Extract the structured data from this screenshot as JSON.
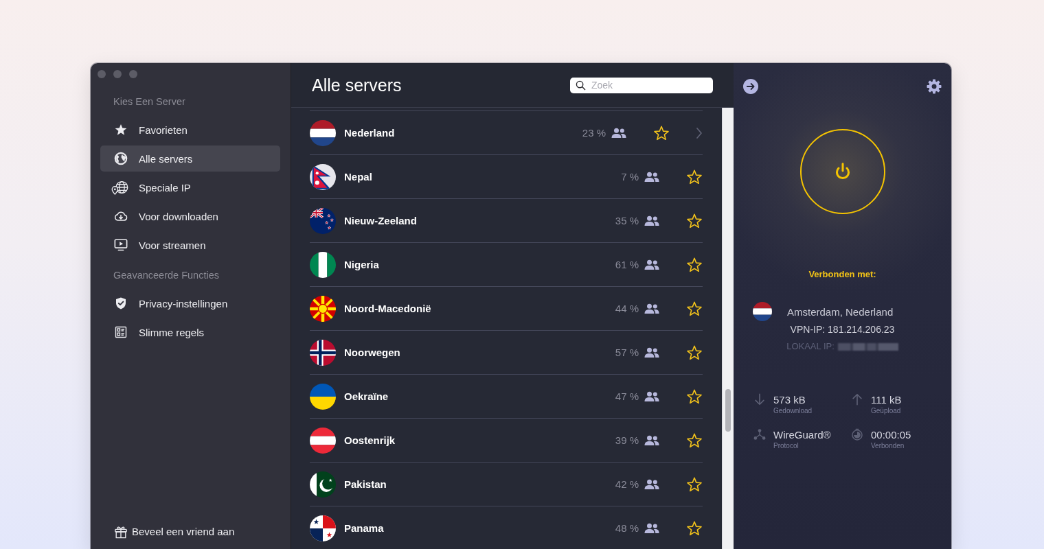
{
  "sidebar": {
    "sections": [
      {
        "heading": "Kies Een Server",
        "items": [
          {
            "label": "Favorieten",
            "kind": "favorites",
            "selected": false
          },
          {
            "label": "Alle servers",
            "kind": "global",
            "selected": true
          },
          {
            "label": "Speciale IP",
            "kind": "dedicated",
            "selected": false
          },
          {
            "label": "Voor downloaden",
            "kind": "downloading",
            "selected": false
          },
          {
            "label": "Voor streamen",
            "kind": "streaming",
            "selected": false
          }
        ]
      },
      {
        "heading": "Geavanceerde Functies",
        "items": [
          {
            "label": "Privacy-instellingen",
            "kind": "privacy",
            "selected": false
          },
          {
            "label": "Slimme regels",
            "kind": "rules",
            "selected": false
          }
        ]
      }
    ],
    "invite": {
      "label": "Beveel een vriend aan"
    }
  },
  "main": {
    "title": "Alle servers",
    "search": {
      "placeholder": "Zoek"
    }
  },
  "servers": [
    {
      "name": "Nederland",
      "load": "23 %",
      "favorite": false,
      "hovered": true
    },
    {
      "name": "Nepal",
      "load": "7 %",
      "favorite": false,
      "hovered": false
    },
    {
      "name": "Nieuw-Zeeland",
      "load": "35 %",
      "favorite": false,
      "hovered": false
    },
    {
      "name": "Nigeria",
      "load": "61 %",
      "favorite": false,
      "hovered": false
    },
    {
      "name": "Noord-Macedonië",
      "load": "44 %",
      "favorite": false,
      "hovered": false
    },
    {
      "name": "Noorwegen",
      "load": "57 %",
      "favorite": false,
      "hovered": false
    },
    {
      "name": "Oekraïne",
      "load": "47 %",
      "favorite": false,
      "hovered": false
    },
    {
      "name": "Oostenrijk",
      "load": "39 %",
      "favorite": false,
      "hovered": false
    },
    {
      "name": "Pakistan",
      "load": "42 %",
      "favorite": false,
      "hovered": false
    },
    {
      "name": "Panama",
      "load": "48 %",
      "favorite": false,
      "hovered": false
    }
  ],
  "connection": {
    "connected": true,
    "status": "Verbonden met:",
    "location": "Amsterdam, Nederland",
    "vpn_ip": "VPN-IP: 181.214.206.23",
    "local_ip_label": "LOKAAL IP:",
    "stats": [
      {
        "kind": "download",
        "value": "573 kB",
        "label": "Gedownload"
      },
      {
        "kind": "upload",
        "value": "111 kB",
        "label": "Geüpload"
      },
      {
        "kind": "protocol",
        "value": "WireGuard®",
        "label": "Protocol"
      },
      {
        "kind": "timer",
        "value": "00:00:05",
        "label": "Verbonden"
      }
    ]
  }
}
